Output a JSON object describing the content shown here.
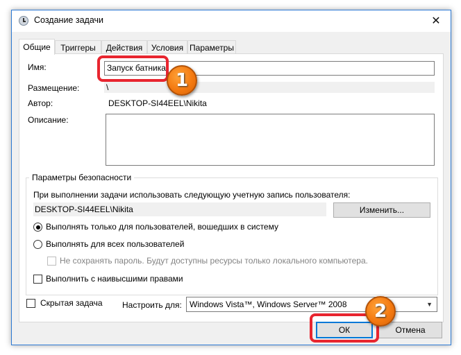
{
  "window": {
    "title": "Создание задачи",
    "close_glyph": "✕",
    "icon": "task-scheduler-clock-icon"
  },
  "tabs": [
    {
      "label": "Общие",
      "active": true
    },
    {
      "label": "Триггеры",
      "active": false
    },
    {
      "label": "Действия",
      "active": false
    },
    {
      "label": "Условия",
      "active": false
    },
    {
      "label": "Параметры",
      "active": false
    }
  ],
  "general": {
    "name_label": "Имя:",
    "name_value": "Запуск батника",
    "location_label": "Размещение:",
    "location_value": "\\",
    "author_label": "Автор:",
    "author_value": "DESKTOP-SI44EEL\\Nikita",
    "description_label": "Описание:",
    "description_value": ""
  },
  "security": {
    "legend": "Параметры безопасности",
    "account_prompt": "При выполнении задачи использовать следующую учетную запись пользователя:",
    "account_value": "DESKTOP-SI44EEL\\Nikita",
    "change_button": "Изменить...",
    "radio_logged_on": "Выполнять только для пользователей, вошедших в систему",
    "radio_all_users": "Выполнять для всех пользователей",
    "no_store_password": "Не сохранять пароль. Будут доступны ресурсы только локального компьютера.",
    "highest_privileges": "Выполнить с наивысшими правами"
  },
  "footer": {
    "hidden_label": "Скрытая задача",
    "configure_label": "Настроить для:",
    "configure_value": "Windows Vista™, Windows Server™ 2008",
    "ok_button": "ОК",
    "cancel_button": "Отмена"
  },
  "annotations": {
    "marker_1": "1",
    "marker_2": "2",
    "highlight_color": "#e8252f",
    "badge_color": "#f47a11"
  }
}
